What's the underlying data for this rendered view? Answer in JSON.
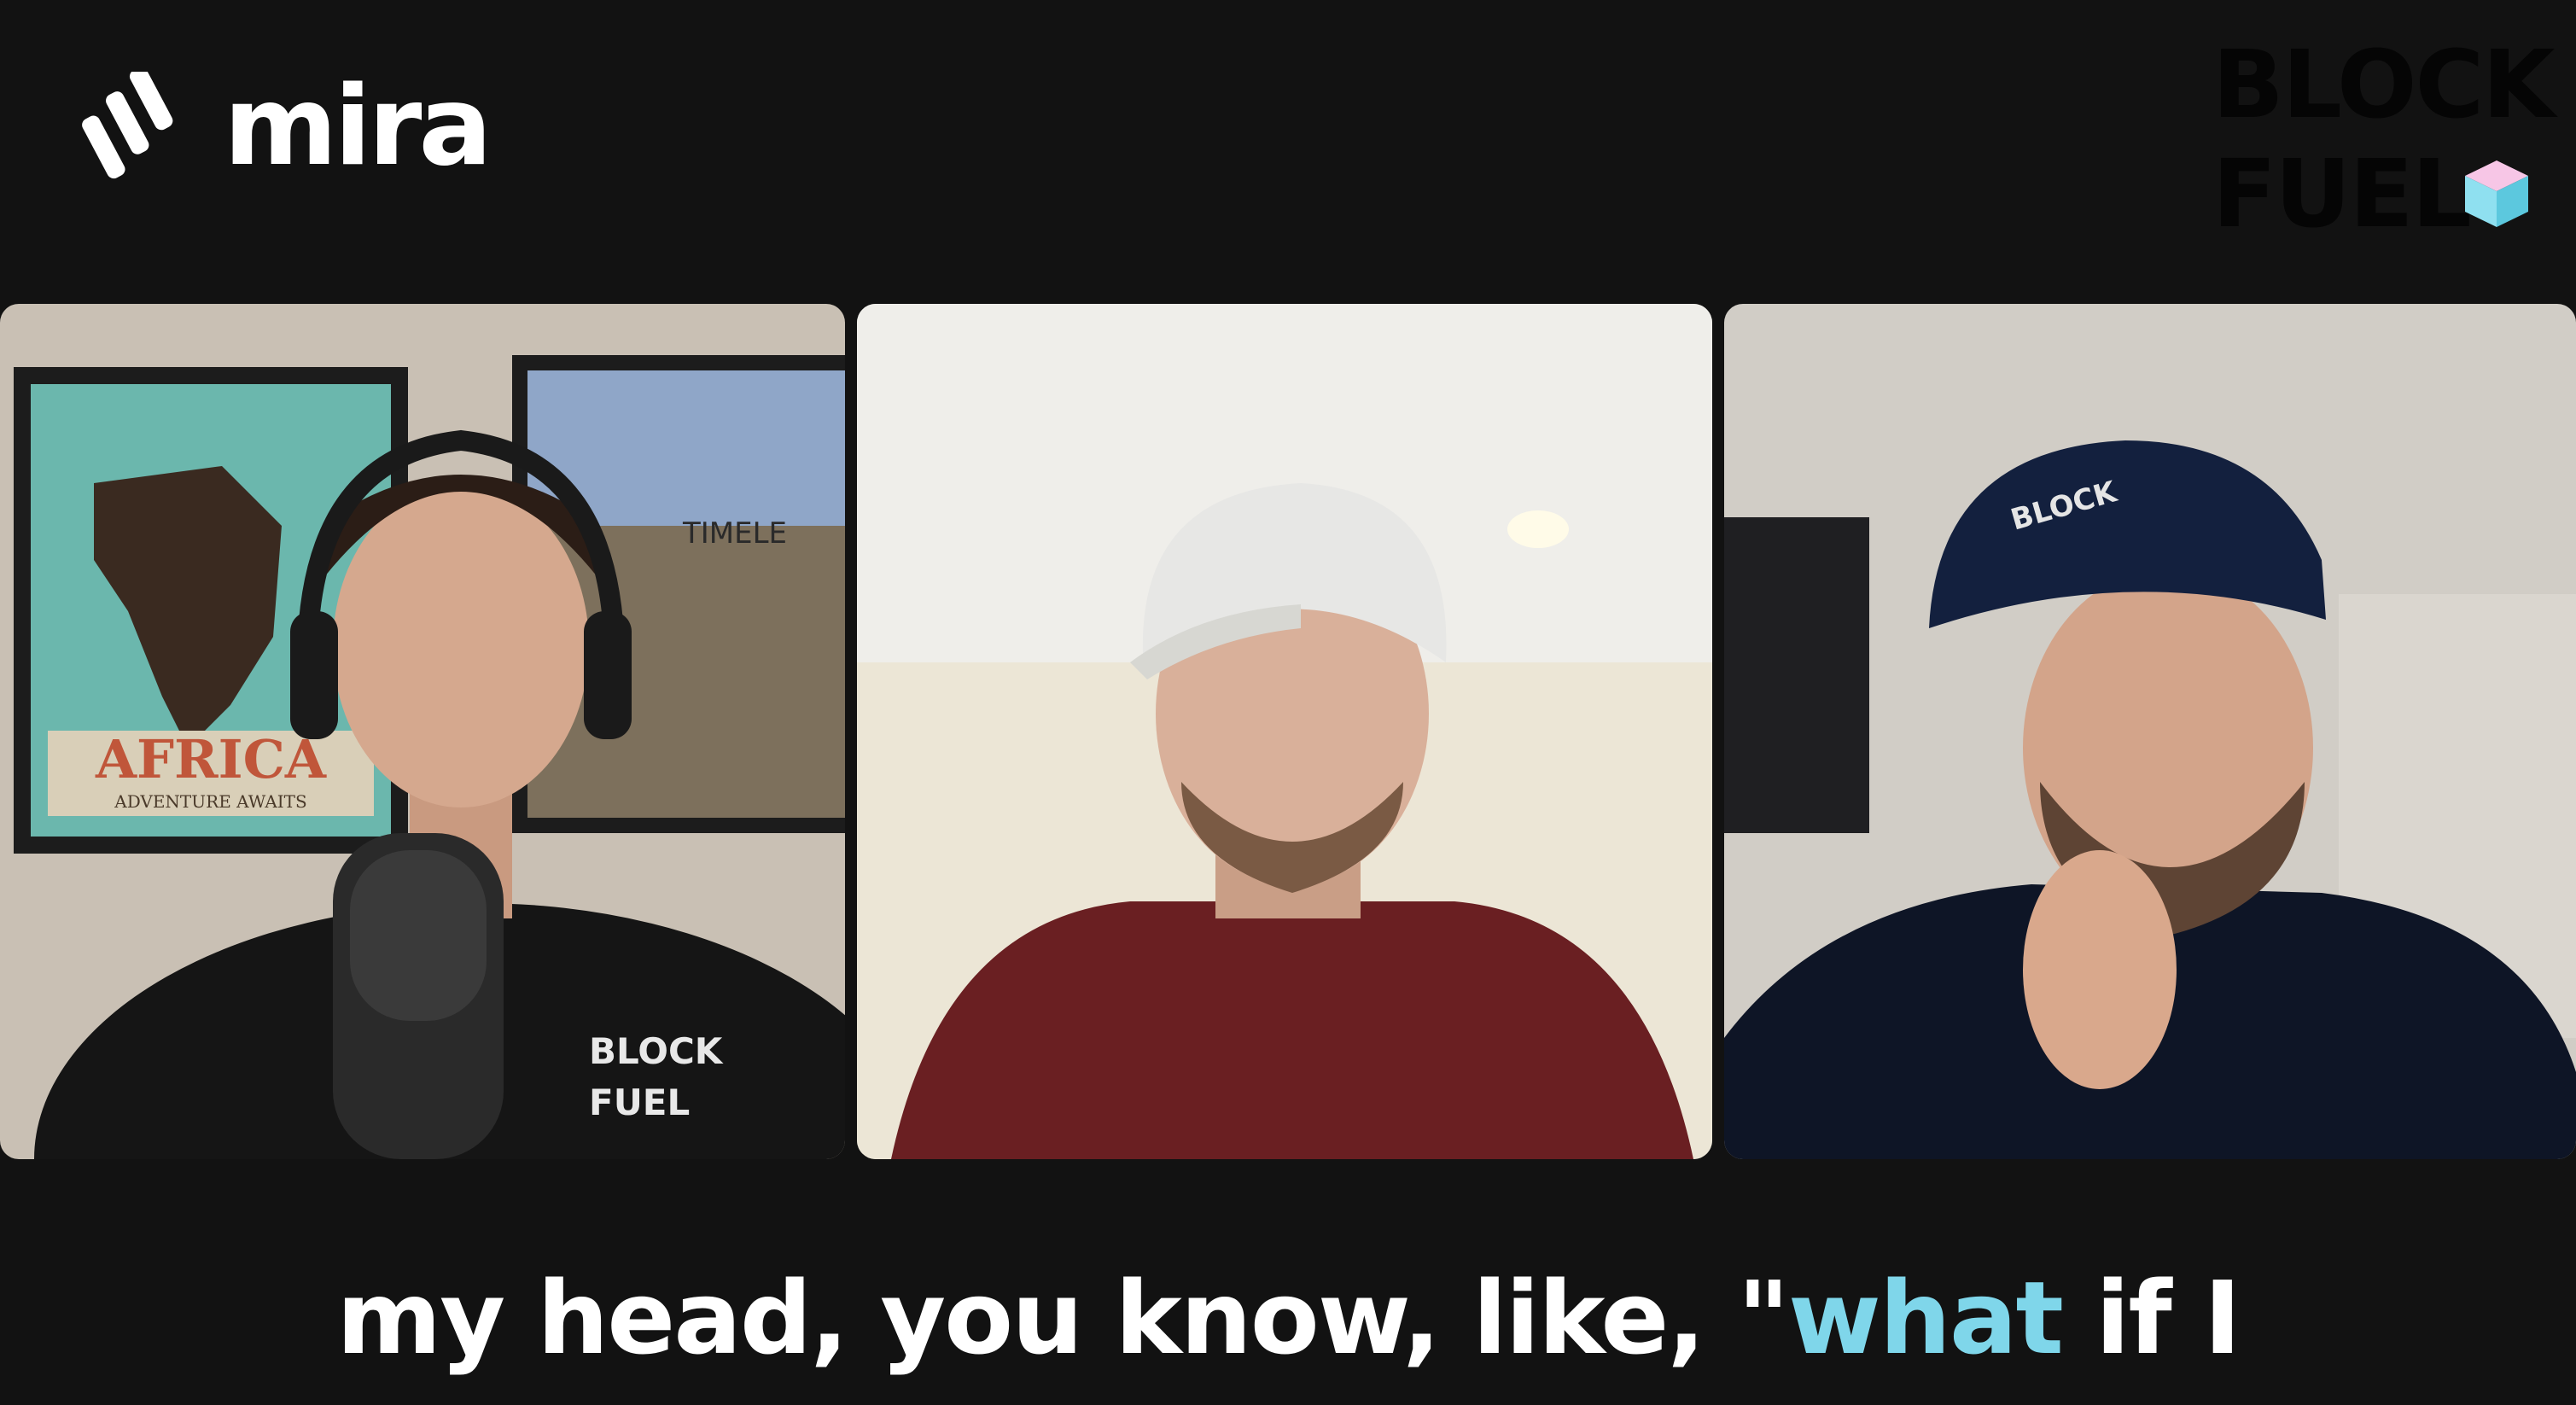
{
  "brand": {
    "app_name": "mira",
    "logo_icon": "mira-stripes-logo-icon",
    "watermark_line1": "BLOCK",
    "watermark_line2": "FUEL",
    "watermark_icon": "cube-icon"
  },
  "participants": [
    {
      "tile_name": "participant-tile-1",
      "poster_title": "AFRICA",
      "poster_subtitle": "ADVENTURE AWAITS",
      "poster2_text": "TIMELE",
      "shirt_line1": "BLOCK",
      "shirt_line2": "FUEL"
    },
    {
      "tile_name": "participant-tile-2"
    },
    {
      "tile_name": "participant-tile-3",
      "cap_text": "BLOCK"
    }
  ],
  "caption": {
    "before": "my head, you know, like, \"",
    "highlight": "what",
    "after": " if I"
  },
  "colors": {
    "background": "#121212",
    "caption_text": "#ffffff",
    "caption_highlight": "#7fd6ea",
    "watermark_text": "#050505"
  }
}
